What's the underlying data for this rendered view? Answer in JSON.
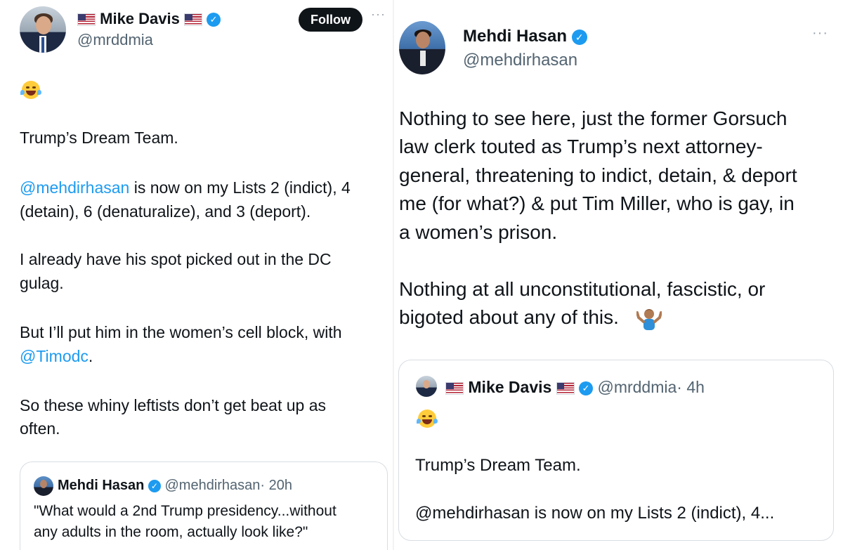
{
  "left_tweet": {
    "author_name": "Mike Davis",
    "author_handle": "@mrddmia",
    "follow_label": "Follow",
    "more_label": "···",
    "body_lines": [
      "Trump’s Dream Team.",
      "is now on my Lists 2 (indict), 4",
      "(detain), 6 (denaturalize), and 3 (deport).",
      "I already have his spot picked out in the DC",
      "gulag.",
      "But I’ll put him in the women’s cell block, with",
      "So these whiny leftists don’t get beat up as",
      "often."
    ],
    "mention_1": "@mehdirhasan",
    "mention_2": "@Timodc",
    "mention_2_suffix": ".",
    "quote": {
      "author_name": "Mehdi Hasan",
      "author_handle": "@mehdirhasan",
      "time": "· 20h",
      "line1": "\"What would a 2nd Trump presidency...without",
      "line2": "any adults in the room, actually look like?\""
    }
  },
  "right_tweet": {
    "author_name": "Mehdi Hasan",
    "author_handle": "@mehdirhasan",
    "more_label": "···",
    "body_lines": [
      "Nothing to see here, just the former Gorsuch",
      "law clerk touted as Trump’s next attorney-",
      "general, threatening to indict, detain, & deport",
      "me (for what?) & put Tim Miller, who is gay, in",
      "a women’s prison.",
      "Nothing at all unconstitutional, fascistic, or",
      "bigoted about any of this."
    ],
    "quote": {
      "author_name": "Mike Davis",
      "author_handle": "@mrddmia",
      "time": "· 4h",
      "line1": "Trump’s Dream Team.",
      "line2": "@mehdirhasan is now on my Lists 2 (indict), 4..."
    }
  },
  "icons": {
    "verified": "verified-badge-icon",
    "flag": "us-flag-icon",
    "laugh": "tears-of-joy-emoji",
    "shrug": "person-shrugging-emoji"
  },
  "colors": {
    "link": "#1d9bf0",
    "text": "#0f1419",
    "muted": "#536471",
    "follow_bg": "#0f1419"
  }
}
